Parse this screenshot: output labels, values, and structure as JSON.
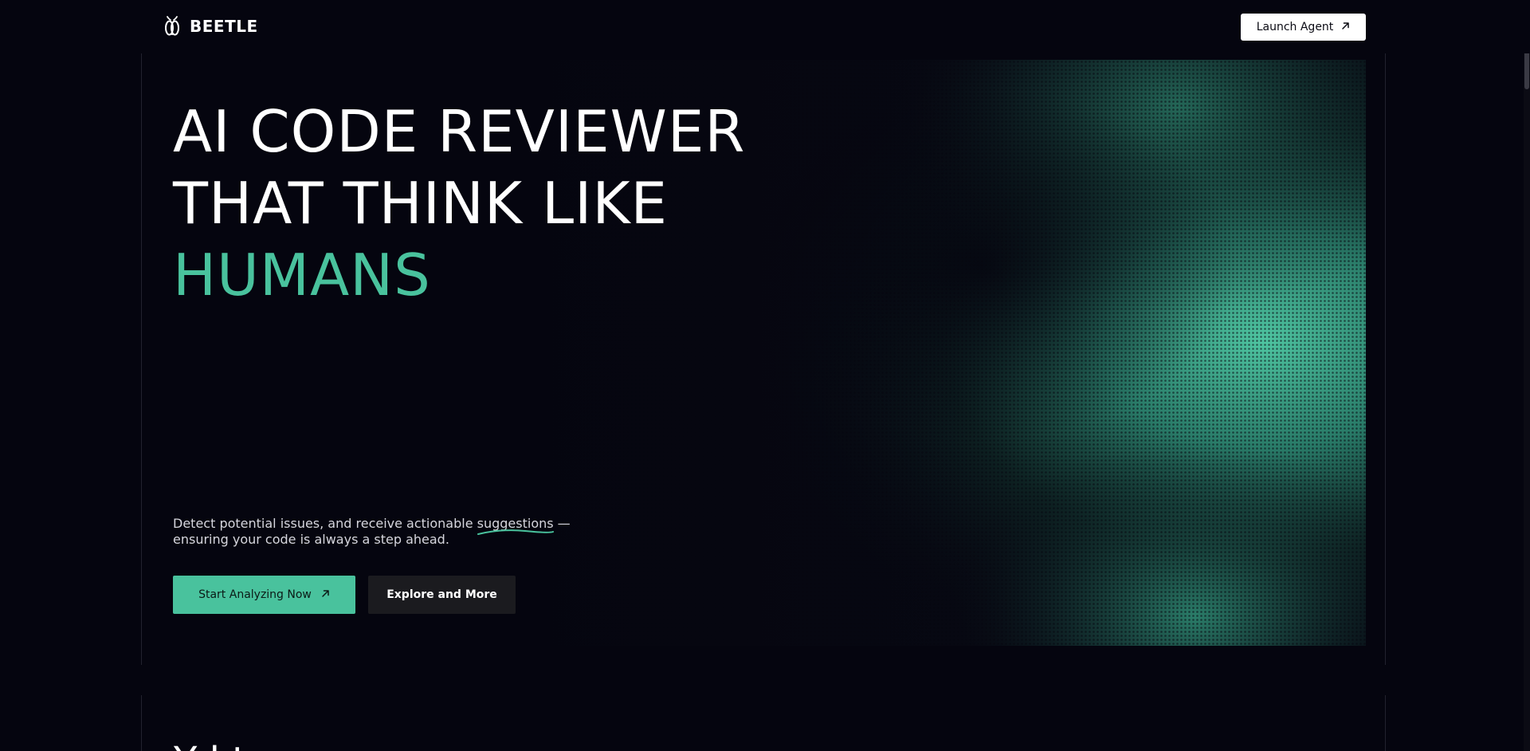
{
  "brand": {
    "name": "BEETLE",
    "logo_icon": "beetle-logo-icon"
  },
  "nav": {
    "launch_label": "Launch Agent",
    "launch_icon": "arrow-up-right-icon"
  },
  "hero": {
    "title_line1": "AI CODE REVIEWER",
    "title_line2": "THAT THINK LIKE",
    "title_line3": "HUMANS",
    "desc_before": "Detect potential issues, and receive actionable ",
    "desc_highlight": "suggestions",
    "desc_after": " — ensuring your code is always a step ahead.",
    "primary_label": "Start Analyzing Now",
    "primary_icon": "arrow-up-right-icon",
    "secondary_label": "Explore and More"
  },
  "section_two": {
    "heading_partial": "Y              l         t"
  },
  "colors": {
    "background": "#05050f",
    "accent": "#49c29d",
    "secondary_button": "#1b1b1f",
    "nav_button": "#ffffff"
  }
}
